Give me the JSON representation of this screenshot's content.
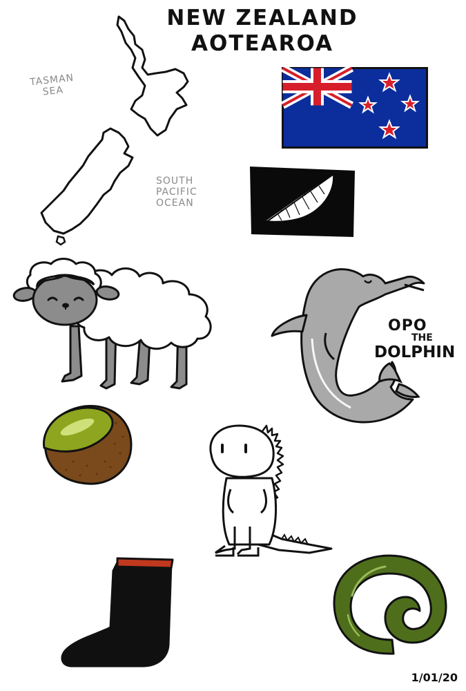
{
  "title": {
    "line1": "NEW ZEALAND",
    "line2": "AOTEAROA"
  },
  "map_labels": {
    "tasman_line1": "TASMAN",
    "tasman_line2": "SEA",
    "pacific_line1": "SOUTH",
    "pacific_line2": "PACIFIC",
    "pacific_line3": "OCEAN"
  },
  "dolphin_caption": {
    "line1": "OPO",
    "line2": "THE",
    "line3": "DOLPHIN"
  },
  "date": "1/01/20",
  "colors": {
    "flag_blue": "#0b2e9c",
    "flag_red": "#d71f2b",
    "sheep_gray": "#8c8c8c",
    "dolphin_gray": "#a9a9a9",
    "kiwi_green": "#8ea51f",
    "kiwi_skin": "#7a4a1c",
    "greenstone": "#4e6e1c",
    "gumboot_black": "#101010",
    "gumboot_red": "#c0391f"
  },
  "icons": [
    "nz-map-icon",
    "nz-flag-icon",
    "silver-fern-flag-icon",
    "sheep-icon",
    "dolphin-icon",
    "kiwifruit-icon",
    "tuatara-icon",
    "gumboot-icon",
    "koru-pendant-icon"
  ]
}
